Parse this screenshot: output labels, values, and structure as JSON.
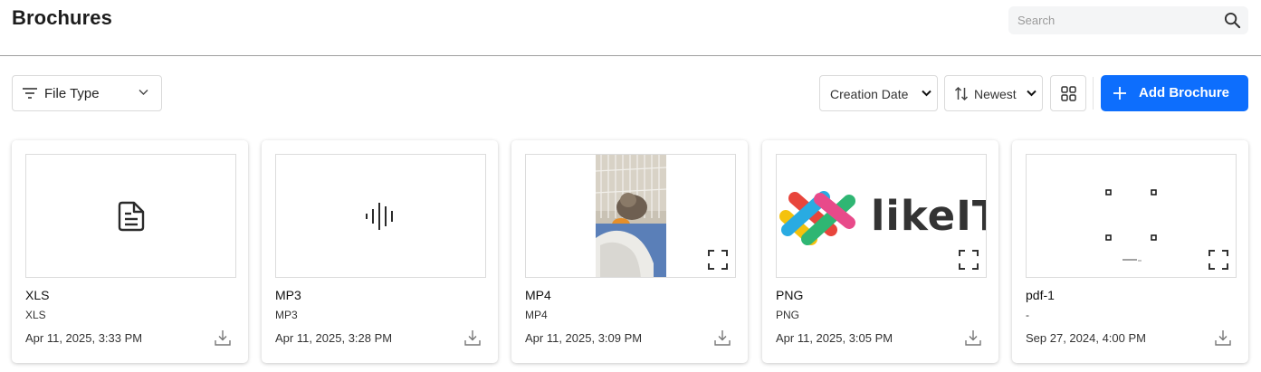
{
  "header": {
    "title": "Brochures",
    "search_placeholder": "Search"
  },
  "toolbar": {
    "filter_label": "File Type",
    "sort_field": "Creation Date",
    "sort_order": "Newest",
    "add_label": "Add Brochure"
  },
  "colors": {
    "primary": "#0d6efd",
    "border": "#dadada"
  },
  "cards": [
    {
      "name": "XLS",
      "type": "XLS",
      "date": "Apr 11, 2025, 3:33 PM",
      "thumb": "document-icon"
    },
    {
      "name": "MP3",
      "type": "MP3",
      "date": "Apr 11, 2025, 3:28 PM",
      "thumb": "audio-waveform-icon"
    },
    {
      "name": "MP4",
      "type": "MP4",
      "date": "Apr 11, 2025, 3:09 PM",
      "thumb": "video-frame-cat"
    },
    {
      "name": "PNG",
      "type": "PNG",
      "date": "Apr 11, 2025, 3:05 PM",
      "thumb": "likeit-logo"
    },
    {
      "name": "pdf-1",
      "type": "-",
      "date": "Sep 27, 2024, 4:00 PM",
      "thumb": "pdf-page-preview"
    }
  ],
  "logo_text": "likeIT"
}
